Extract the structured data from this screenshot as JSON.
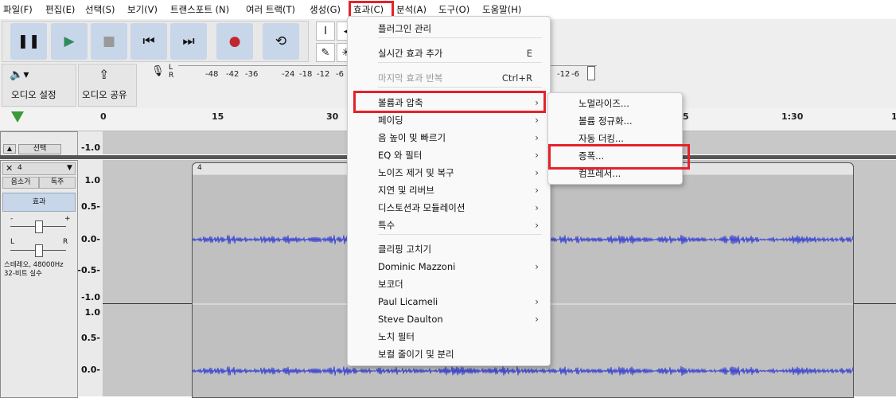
{
  "menubar": {
    "items": [
      "파일(F)",
      "편집(E)",
      "선택(S)",
      "보기(V)",
      "트랜스포트 (N)",
      "여러 트랙(T)",
      "생성(G)",
      "효과(C)",
      "분석(A)",
      "도구(O)",
      "도움말(H)"
    ]
  },
  "toolbar": {
    "audio_settings": "오디오 설정",
    "audio_share": "오디오 공유",
    "meter_lr_top": "L\nR",
    "meter_scale": [
      "-48",
      "-42",
      "-36",
      "-24",
      "-18",
      "-12",
      "-6"
    ],
    "meter_scale_right": [
      "-12",
      "-6"
    ]
  },
  "ruler": {
    "ticks": [
      "0",
      "15",
      "30",
      "5",
      "1:30",
      "1"
    ]
  },
  "top_track": {
    "select_label": "선택",
    "scale_bottom": "-1.0"
  },
  "track": {
    "name": "4",
    "mute": "음소거",
    "solo": "독주",
    "effects": "효과",
    "gain_minus": "-",
    "gain_plus": "+",
    "pan_l": "L",
    "pan_r": "R",
    "info_line1": "스테레오, 48000Hz",
    "info_line2": "32-비트 실수",
    "clip_name": "4",
    "scale": [
      "1.0",
      "0.5-",
      "0.0-",
      "-0.5-",
      "-1.0",
      "1.0",
      "0.5-",
      "0.0-"
    ]
  },
  "effect_menu": {
    "items": [
      {
        "label": "플러그인 관리",
        "shortcut": "",
        "arrow": false,
        "disabled": false
      },
      {
        "label": "실시간 효과 추가",
        "shortcut": "E",
        "arrow": false,
        "disabled": false
      },
      {
        "label": "마지막 효과 반복",
        "shortcut": "Ctrl+R",
        "arrow": false,
        "disabled": true
      },
      {
        "label": "볼륨과 압축",
        "shortcut": "",
        "arrow": true,
        "disabled": false
      },
      {
        "label": "페이딩",
        "shortcut": "",
        "arrow": true,
        "disabled": false
      },
      {
        "label": "음 높이 및 빠르기",
        "shortcut": "",
        "arrow": true,
        "disabled": false
      },
      {
        "label": "EQ 와 필터",
        "shortcut": "",
        "arrow": true,
        "disabled": false
      },
      {
        "label": "노이즈 제거 및 복구",
        "shortcut": "",
        "arrow": true,
        "disabled": false
      },
      {
        "label": "지연 및 리버브",
        "shortcut": "",
        "arrow": true,
        "disabled": false
      },
      {
        "label": "디스토션과 모듈레이션",
        "shortcut": "",
        "arrow": true,
        "disabled": false
      },
      {
        "label": "특수",
        "shortcut": "",
        "arrow": true,
        "disabled": false
      },
      {
        "label": "클리핑 고치기",
        "shortcut": "",
        "arrow": false,
        "disabled": false
      },
      {
        "label": "Dominic Mazzoni",
        "shortcut": "",
        "arrow": true,
        "disabled": false
      },
      {
        "label": "보코더",
        "shortcut": "",
        "arrow": false,
        "disabled": false
      },
      {
        "label": "Paul Licameli",
        "shortcut": "",
        "arrow": true,
        "disabled": false
      },
      {
        "label": "Steve Daulton",
        "shortcut": "",
        "arrow": true,
        "disabled": false
      },
      {
        "label": "노치 필터",
        "shortcut": "",
        "arrow": false,
        "disabled": false
      },
      {
        "label": "보컬 줄이기 및 분리",
        "shortcut": "",
        "arrow": false,
        "disabled": false
      }
    ]
  },
  "submenu": {
    "items": [
      "노멀라이즈...",
      "볼륨 정규화...",
      "자동 더킹...",
      "증폭...",
      "컴프레서..."
    ]
  },
  "colors": {
    "highlight": "#e5212b",
    "button": "#c8d6ea",
    "waveform": "#3c46d0"
  }
}
